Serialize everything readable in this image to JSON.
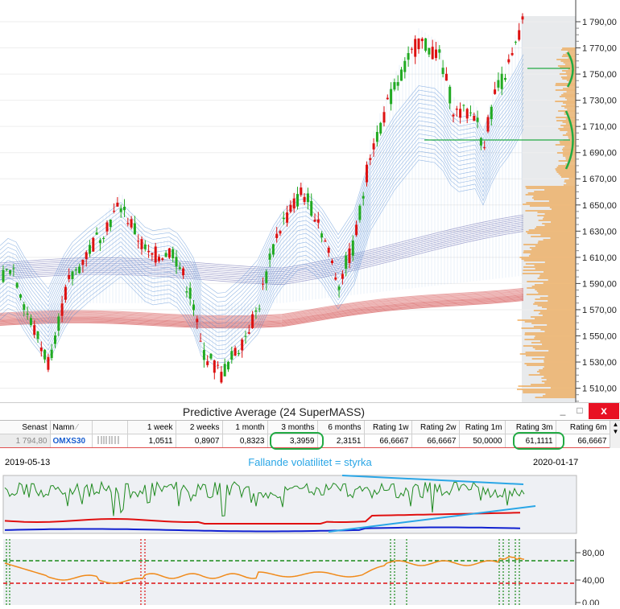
{
  "main_chart": {
    "price_axis_labels": [
      "1 790,00",
      "1 770,00",
      "1 750,00",
      "1 730,00",
      "1 710,00",
      "1 690,00",
      "1 670,00",
      "1 650,00",
      "1 630,00",
      "1 610,00",
      "1 590,00",
      "1 570,00",
      "1 550,00",
      "1 530,00",
      "1 510,00"
    ],
    "colors": {
      "up": "#22aa22",
      "down": "#dd1111",
      "ribbon_blue": "#3f7fd0",
      "ribbon_red": "#cc3333",
      "annot": "#22aa44",
      "volume_profile": "#f0a040"
    }
  },
  "window": {
    "title": "Predictive Average (24  SuperMASS)",
    "close_glyph": "x",
    "minimize_glyph": "_",
    "maximize_glyph": "□"
  },
  "grid": {
    "headers": [
      "Senast",
      "Namn",
      "",
      "1 week",
      "2 weeks",
      "1 month",
      "3 months",
      "6 months",
      "Rating 1w",
      "Rating 2w",
      "Rating 1m",
      "Rating 3m",
      "Rating 6m"
    ],
    "row": [
      "1 794,80",
      "OMXS30",
      "",
      "1,0511",
      "0,8907",
      "0,8323",
      "3,3959",
      "2,3151",
      "66,6667",
      "66,6667",
      "50,0000",
      "61,1111",
      "66,6667"
    ],
    "highlight_color": "#22aa44"
  },
  "datebar": {
    "start_date": "2019-05-13",
    "end_date": "2020-01-17",
    "annotation": "Fallande volatilitet = styrka"
  },
  "rating_panel": {
    "axis_labels": [
      "80,00",
      "40,00",
      "0,00"
    ],
    "dashed_high_color": "#1a8a1a",
    "dashed_low_color": "#dd1111"
  }
}
